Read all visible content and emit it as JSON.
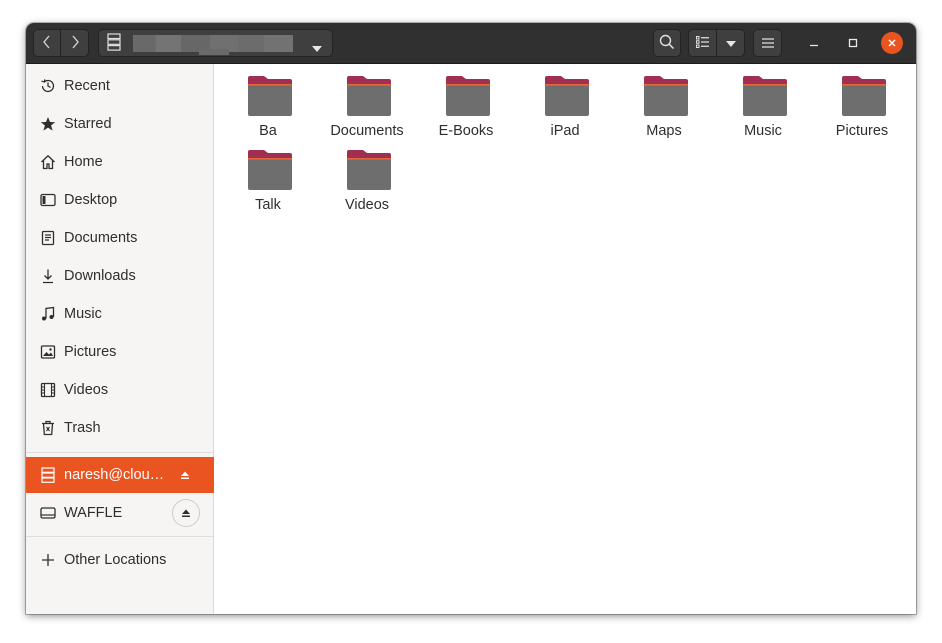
{
  "header": {
    "path_dropdown_icon": "triangle-down-icon",
    "server_icon": "server-icon",
    "search_icon": "search-icon",
    "list_view_icon": "list-view-icon",
    "view_options_icon": "triangle-down-icon",
    "menu_icon": "hamburger-menu-icon",
    "close_color": "#e95420"
  },
  "sidebar": {
    "items": [
      {
        "label": "Recent",
        "icon": "clock-icon"
      },
      {
        "label": "Starred",
        "icon": "star-icon"
      },
      {
        "label": "Home",
        "icon": "home-icon"
      },
      {
        "label": "Desktop",
        "icon": "desktop-icon"
      },
      {
        "label": "Documents",
        "icon": "document-icon"
      },
      {
        "label": "Downloads",
        "icon": "download-icon"
      },
      {
        "label": "Music",
        "icon": "music-icon"
      },
      {
        "label": "Pictures",
        "icon": "picture-icon"
      },
      {
        "label": "Videos",
        "icon": "film-icon"
      },
      {
        "label": "Trash",
        "icon": "trash-icon"
      }
    ],
    "mounts": [
      {
        "label": "naresh@clou…",
        "icon": "server-icon",
        "active": true
      },
      {
        "label": "WAFFLE",
        "icon": "drive-icon",
        "active": false
      }
    ],
    "other_locations": {
      "label": "Other Locations",
      "icon": "plus-icon"
    },
    "accent": "#e95420"
  },
  "folders": [
    {
      "label": "Ba"
    },
    {
      "label": "Documents"
    },
    {
      "label": "E-Books"
    },
    {
      "label": "iPad"
    },
    {
      "label": "Maps"
    },
    {
      "label": "Music"
    },
    {
      "label": "Pictures"
    },
    {
      "label": "Talk"
    },
    {
      "label": "Videos"
    }
  ]
}
